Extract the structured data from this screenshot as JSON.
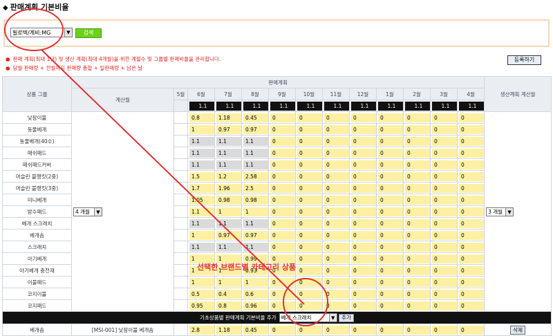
{
  "page_title": "판매계획 기본비율",
  "search": {
    "brand_value": "필로텍/계비:MG",
    "search_label": "검색"
  },
  "notes": [
    "판매 계획(최대 1년) 및 생산 계획(최대 4개월)을 위한 계절수 및 그룹별 판매비율을 관리합니다.",
    "당월 판매량 + 전월까지 판매량 총합 + 일판매량 + 남은 날"
  ],
  "register_label": "등록하기",
  "headers": {
    "group": "상품 그룹",
    "sales_plan": "판매계획",
    "calc_month": "계산월",
    "production_calc": "생산계획 계산월"
  },
  "months": [
    "5월",
    "6월",
    "7월",
    "8월",
    "9월",
    "10월",
    "11월",
    "12월",
    "1월",
    "2월",
    "3월",
    "4월"
  ],
  "ratio_row": [
    "1.1",
    "1.1",
    "1.1",
    "1.1",
    "1.1",
    "1.1",
    "1.1",
    "1.1",
    "1.1",
    "1.1",
    "1.1"
  ],
  "calc_month_select": "4 개월",
  "production_select": "3 개월",
  "rows": [
    {
      "name": "낮잠이불",
      "vals": [
        "0.8",
        "1.18",
        "0.45",
        "0",
        "0",
        "0",
        "0",
        "0",
        "0",
        "0",
        "0"
      ]
    },
    {
      "name": "동물베개",
      "vals": [
        "1",
        "0.97",
        "0.97",
        "0",
        "0",
        "0",
        "0",
        "0",
        "0",
        "0",
        "0"
      ]
    },
    {
      "name": "동물베개(40수)",
      "vals": [
        "1.1",
        "1.1",
        "1.1",
        "0",
        "0",
        "0",
        "0",
        "0",
        "0",
        "0",
        "0"
      ]
    },
    {
      "name": "매쉬패드",
      "vals": [
        "1.1",
        "1.1",
        "1.1",
        "0",
        "0",
        "0",
        "0",
        "0",
        "0",
        "0",
        "0"
      ]
    },
    {
      "name": "매쉬패드커버",
      "vals": [
        "1.1",
        "1.1",
        "1.1",
        "0",
        "0",
        "0",
        "0",
        "0",
        "0",
        "0",
        "0"
      ]
    },
    {
      "name": "머슬린 블랭킷(2중)",
      "vals": [
        "1.5",
        "1.2",
        "2.58",
        "0",
        "0",
        "0",
        "0",
        "0",
        "0",
        "0",
        "0"
      ]
    },
    {
      "name": "머슬린 블랭킷(3중)",
      "vals": [
        "1.7",
        "1.96",
        "2.5",
        "0",
        "0",
        "0",
        "0",
        "0",
        "0",
        "0",
        "0"
      ]
    },
    {
      "name": "미니베개",
      "vals": [
        "1.05",
        "0.98",
        "0.98",
        "0",
        "0",
        "0",
        "0",
        "0",
        "0",
        "0",
        "0"
      ]
    },
    {
      "name": "방수패드",
      "vals": [
        "1.1",
        "1",
        "1",
        "0",
        "0",
        "0",
        "0",
        "0",
        "0",
        "0",
        "0"
      ]
    },
    {
      "name": "베개 스크래치",
      "vals": [
        "1.1",
        "1.1",
        "1.1",
        "0",
        "0",
        "0",
        "0",
        "0",
        "0",
        "0",
        "0"
      ]
    },
    {
      "name": "베개솜",
      "vals": [
        "1",
        "0.97",
        "0.97",
        "0",
        "0",
        "0",
        "0",
        "0",
        "0",
        "0",
        "0"
      ]
    },
    {
      "name": "스크래치",
      "vals": [
        "1.1",
        "1.1",
        "1.1",
        "0",
        "0",
        "0",
        "0",
        "0",
        "0",
        "0",
        "0"
      ]
    },
    {
      "name": "아기베개",
      "vals": [
        "1",
        "1",
        "0.99",
        "0",
        "0",
        "0",
        "0",
        "0",
        "0",
        "0",
        "0"
      ]
    },
    {
      "name": "아기베개 충전재",
      "vals": [
        "1",
        "1",
        "0.93",
        "0",
        "0",
        "0",
        "0",
        "0",
        "0",
        "0",
        "0"
      ]
    },
    {
      "name": "이불패드",
      "vals": [
        "1",
        "1",
        "1",
        "0",
        "0",
        "0",
        "0",
        "0",
        "0",
        "0",
        "0"
      ]
    },
    {
      "name": "코지이불",
      "vals": [
        "0.5",
        "0.4",
        "0.6",
        "0",
        "0",
        "0",
        "0",
        "0",
        "0",
        "0",
        "0"
      ]
    },
    {
      "name": "코지패드",
      "vals": [
        "0.95",
        "0.8",
        "0.96",
        "0",
        "0",
        "0",
        "0",
        "0",
        "0",
        "0",
        "0"
      ]
    }
  ],
  "add_bar": {
    "label": "기초상품별 판매계획 기본비율 추가",
    "select_value": "베개 스크래치",
    "add_label": "추가"
  },
  "added_row": {
    "group": "베개솜",
    "product": "[MSI-001] 낮잠이불 베개솜",
    "vals": [
      "2.8",
      "1.18",
      "0.45",
      "0",
      "0",
      "0",
      "0",
      "0",
      "0",
      "0",
      "0"
    ],
    "delete_label": "삭제"
  },
  "annotation": "선택한 브랜드별 카테고리 상품",
  "colors": {
    "annotation_red": "#e03030",
    "search_green": "#6cd11c",
    "input_yellow": "#fdf0a2",
    "black_bar": "#111111"
  }
}
